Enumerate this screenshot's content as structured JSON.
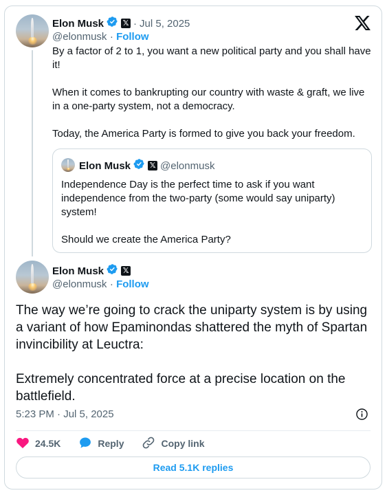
{
  "quoting_tweet": {
    "author": {
      "name": "Elon Musk",
      "handle": "@elonmusk",
      "follow_label": "Follow",
      "verified": true
    },
    "date": "Jul 5, 2025",
    "paragraphs": [
      "By a factor of 2 to 1, you want a new political party and you shall have it!",
      "When it comes to bankrupting our country with waste & graft, we live in a one-party system, not a democracy.",
      "Today, the America Party is formed to give you back your freedom."
    ],
    "quoted": {
      "author_name": "Elon Musk",
      "handle": "@elonmusk",
      "paragraphs": [
        "Independence Day is the perfect time to ask if you want independence from the two-party (some would say uniparty) system!",
        "Should we create the America Party?"
      ]
    }
  },
  "main_tweet": {
    "author": {
      "name": "Elon Musk",
      "handle": "@elonmusk",
      "follow_label": "Follow",
      "verified": true
    },
    "paragraphs": [
      "The way we’re going to crack the uniparty system is by using a variant of how Epaminondas shattered the myth of Spartan invincibility at Leuctra:",
      "Extremely concentrated force at a precise location on the battlefield."
    ],
    "timestamp": "5:23 PM · Jul 5, 2025"
  },
  "actions": {
    "like_count": "24.5K",
    "reply_label": "Reply",
    "copy_link_label": "Copy link"
  },
  "read_replies_label": "Read 5.1K replies",
  "icons": {
    "like": "heart-icon",
    "reply": "speech-bubble-icon",
    "copy": "link-icon",
    "info": "info-icon",
    "verified": "verified-badge-icon",
    "platform": "x-logo-icon"
  },
  "colors": {
    "accent": "#1d9bf0",
    "like": "#f91880",
    "text": "#0f1419",
    "muted": "#536471",
    "border": "#cfd9de"
  }
}
